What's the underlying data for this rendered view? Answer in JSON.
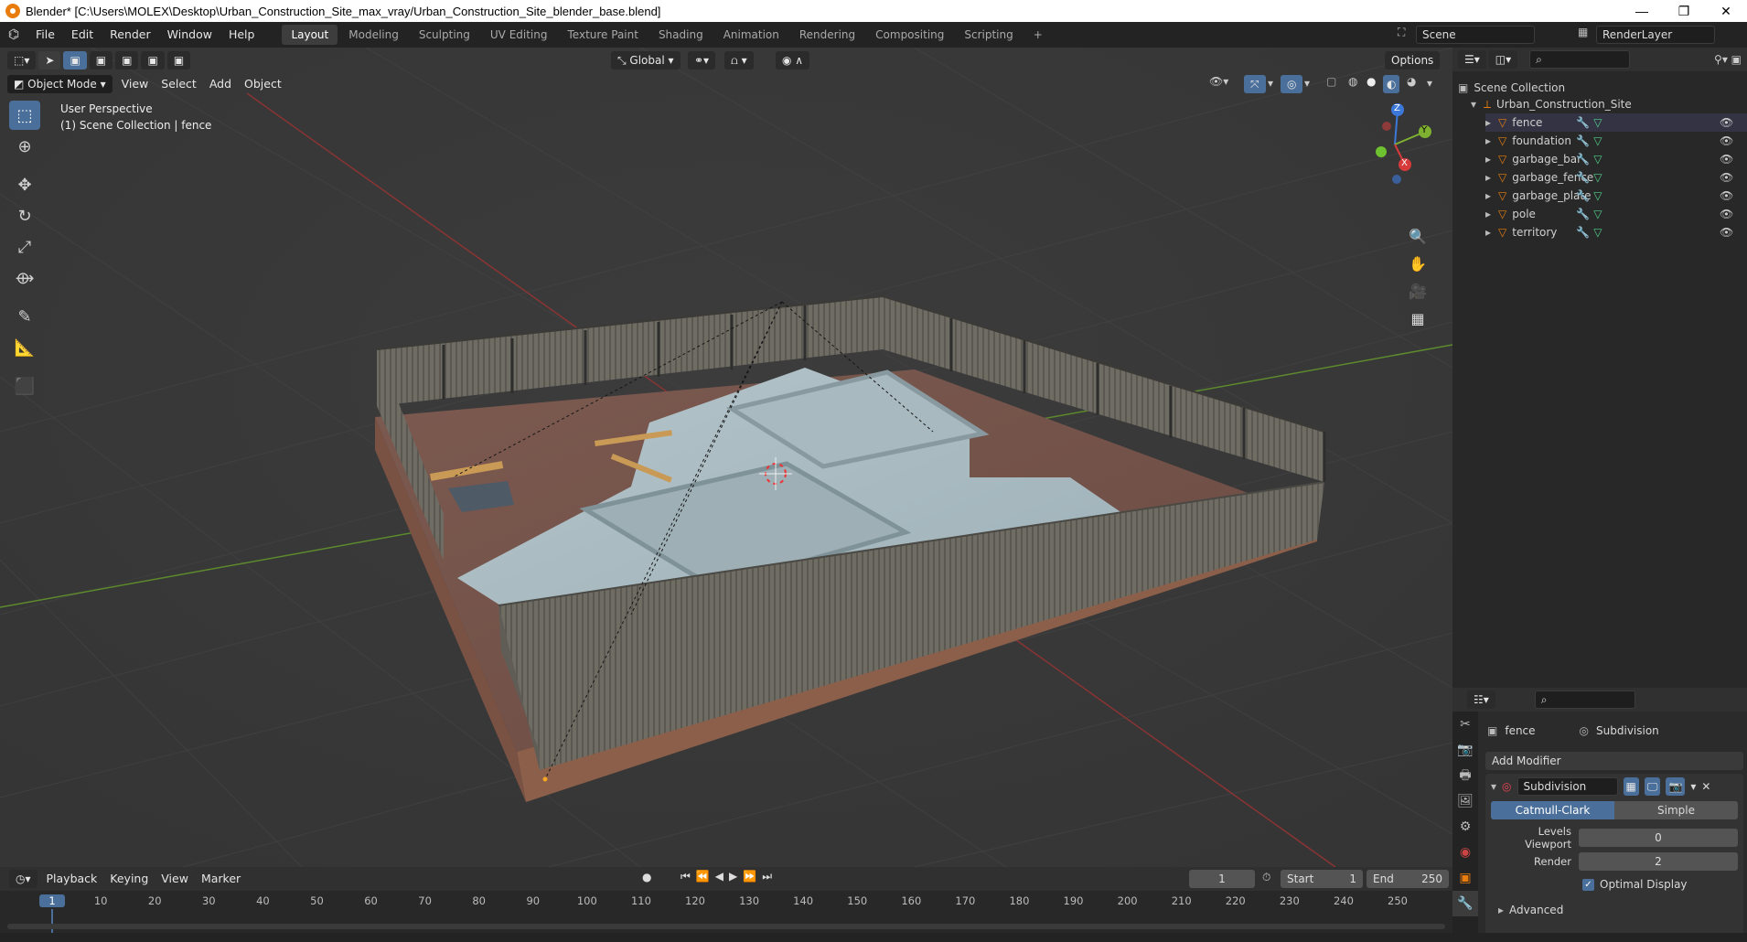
{
  "titlebar": {
    "title": "Blender* [C:\\Users\\MOLEX\\Desktop\\Urban_Construction_Site_max_vray/Urban_Construction_Site_blender_base.blend]",
    "minimize": "—",
    "maximize": "❐",
    "close": "✕"
  },
  "menu": [
    "File",
    "Edit",
    "Render",
    "Window",
    "Help"
  ],
  "workspaces": [
    "Layout",
    "Modeling",
    "Sculpting",
    "UV Editing",
    "Texture Paint",
    "Shading",
    "Animation",
    "Rendering",
    "Compositing",
    "Scripting"
  ],
  "workspace_add": "+",
  "scene": {
    "name": "Scene",
    "renderlayer": "RenderLayer"
  },
  "toolbar_top": {
    "orientation": "Global",
    "options": "Options"
  },
  "viewport": {
    "mode": "Object Mode",
    "menus": [
      "View",
      "Select",
      "Add",
      "Object"
    ],
    "info_line1": "User Perspective",
    "info_line2": "(1) Scene Collection | fence",
    "gizmo": {
      "x": "X",
      "y": "Y",
      "z": "Z"
    }
  },
  "outliner": {
    "root": "Scene Collection",
    "collection": "Urban_Construction_Site",
    "objects": [
      "fence",
      "foundation",
      "garbage_bar",
      "garbage_fence",
      "garbage_plate",
      "pole",
      "territory"
    ]
  },
  "properties": {
    "object": "fence",
    "modifier_tab": "Subdivision",
    "add_modifier": "Add Modifier",
    "modifier_name": "Subdivision",
    "type_a": "Catmull-Clark",
    "type_b": "Simple",
    "levels_viewport_label": "Levels Viewport",
    "levels_viewport": "0",
    "render_label": "Render",
    "render": "2",
    "optimal_display": "Optimal Display",
    "advanced": "Advanced"
  },
  "timeline": {
    "menus": [
      "Playback",
      "Keying",
      "View",
      "Marker"
    ],
    "current_frame": "1",
    "start_label": "Start",
    "start": "1",
    "end_label": "End",
    "end": "250",
    "ticks": [
      "1",
      "10",
      "20",
      "30",
      "40",
      "50",
      "60",
      "70",
      "80",
      "90",
      "100",
      "110",
      "120",
      "130",
      "140",
      "150",
      "160",
      "170",
      "180",
      "190",
      "200",
      "210",
      "220",
      "230",
      "240",
      "250"
    ]
  },
  "colors": {
    "accent": "#4a6f9b",
    "orange": "#e87d0d",
    "bg": "#393939"
  }
}
